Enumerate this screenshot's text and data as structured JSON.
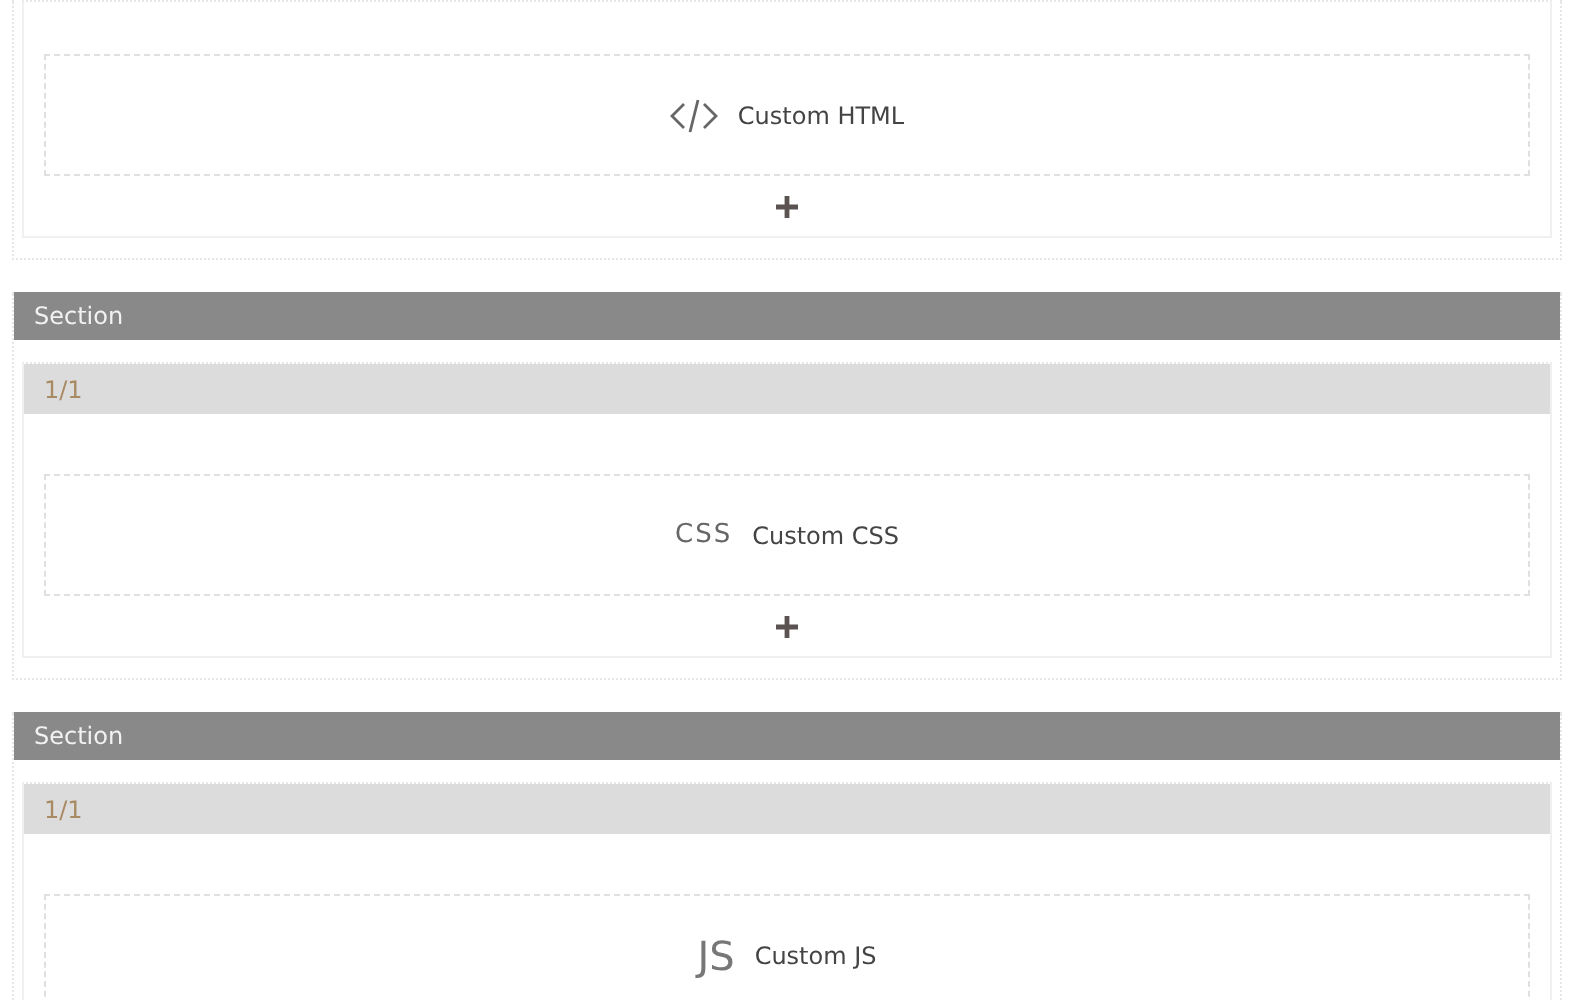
{
  "sections": [
    {
      "element": {
        "kind": "html",
        "label": "Custom HTML"
      },
      "add_button": true
    },
    {
      "title": "Section",
      "column": "1/1",
      "element": {
        "kind": "css",
        "icon_text": "CSS",
        "label": "Custom CSS"
      },
      "add_button": true
    },
    {
      "title": "Section",
      "column": "1/1",
      "element": {
        "kind": "js",
        "icon_text": "JS",
        "label": "Custom JS"
      },
      "add_button": false
    }
  ]
}
